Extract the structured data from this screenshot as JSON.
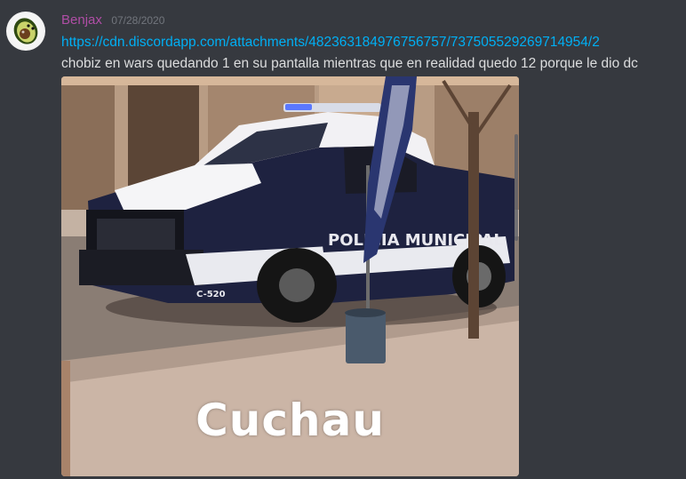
{
  "message": {
    "author": {
      "username": "Benjax",
      "color": "#b04ea6",
      "avatar_icon": "avocado-icon"
    },
    "timestamp": "07/28/2020",
    "link": "https://cdn.discordapp.com/attachments/482363184976756757/737505529269714954/2",
    "text": "chobiz en wars quedando 1 en su pantalla mientras que en realidad quedo 12 porque le dio dc",
    "attachment": {
      "caption": "Cuchau",
      "truck_lettering": "POLICIA MUNICIPAL",
      "truck_unit": "C-520"
    }
  },
  "colors": {
    "background": "#36393f",
    "link": "#00aff4",
    "text": "#dcddde",
    "timestamp": "#72767d"
  }
}
